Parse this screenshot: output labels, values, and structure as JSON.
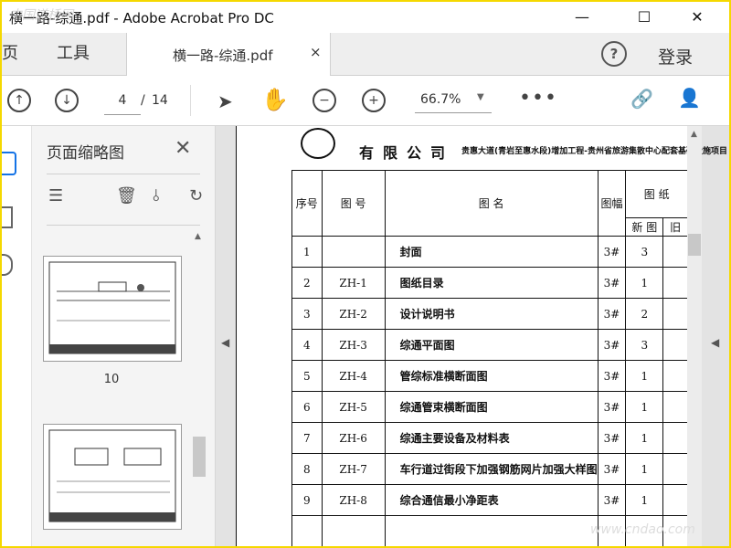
{
  "window": {
    "title": "横一路-综通.pdf - Adobe Acrobat Pro DC",
    "minimize_glyph": "—",
    "maximize_glyph": "☐",
    "close_glyph": "✕"
  },
  "tabs": {
    "home_label": "页",
    "tools_label": "工具",
    "document_label": "横一路-综通.pdf",
    "document_close": "×",
    "help_glyph": "?",
    "login_label": "登录"
  },
  "toolbar": {
    "prev_glyph": "↑",
    "next_glyph": "↓",
    "current_page": "4",
    "page_separator": "/",
    "total_pages": "14",
    "select_glyph": "➤",
    "hand_glyph": "✋",
    "zoom_out_glyph": "−",
    "zoom_in_glyph": "+",
    "zoom_value": "66.7%",
    "zoom_caret": "▼",
    "more_glyph": "•••",
    "link_glyph": "🔗",
    "adduser_glyph": "👤"
  },
  "thumbnail_panel": {
    "title": "页面缩略图",
    "close_glyph": "✕",
    "options_glyph": "☰",
    "delete_glyph": "🗑",
    "insert_glyph": "⫰",
    "rotate_glyph": "↻",
    "thumbnails": [
      {
        "label": "10"
      },
      {
        "label": ""
      }
    ]
  },
  "document": {
    "company": "有限公司",
    "project_title": "贵惠大道(青岩至惠水段)增加工程-贵州省旅游集散中心配套基础设施项目（横一",
    "table_headers": {
      "seq": "序号",
      "drawing_no": "图 号",
      "drawing_name": "图 名",
      "size": "图幅",
      "drawings": "图 纸",
      "new": "新 图",
      "old": "旧"
    },
    "rows": [
      {
        "seq": "1",
        "no": "",
        "name": "封面",
        "size": "3#",
        "count": "3"
      },
      {
        "seq": "2",
        "no": "ZH-1",
        "name": "图纸目录",
        "size": "3#",
        "count": "1"
      },
      {
        "seq": "3",
        "no": "ZH-2",
        "name": "设计说明书",
        "size": "3#",
        "count": "2"
      },
      {
        "seq": "4",
        "no": "ZH-3",
        "name": "综通平面图",
        "size": "3#",
        "count": "3"
      },
      {
        "seq": "5",
        "no": "ZH-4",
        "name": "管综标准横断面图",
        "size": "3#",
        "count": "1"
      },
      {
        "seq": "6",
        "no": "ZH-5",
        "name": "综通管束横断面图",
        "size": "3#",
        "count": "1"
      },
      {
        "seq": "7",
        "no": "ZH-6",
        "name": "综通主要设备及材料表",
        "size": "3#",
        "count": "1"
      },
      {
        "seq": "8",
        "no": "ZH-7",
        "name": "车行道过街段下加强钢筋网片加强大样图",
        "size": "3#",
        "count": "1"
      },
      {
        "seq": "9",
        "no": "ZH-8",
        "name": "综合通信最小净距表",
        "size": "3#",
        "count": "1"
      }
    ]
  },
  "watermarks": {
    "top_left": "中国道桥网",
    "bottom_right": "www.cndao.com"
  },
  "colors": {
    "accent": "#1473e6",
    "window_border": "#f5d800"
  }
}
